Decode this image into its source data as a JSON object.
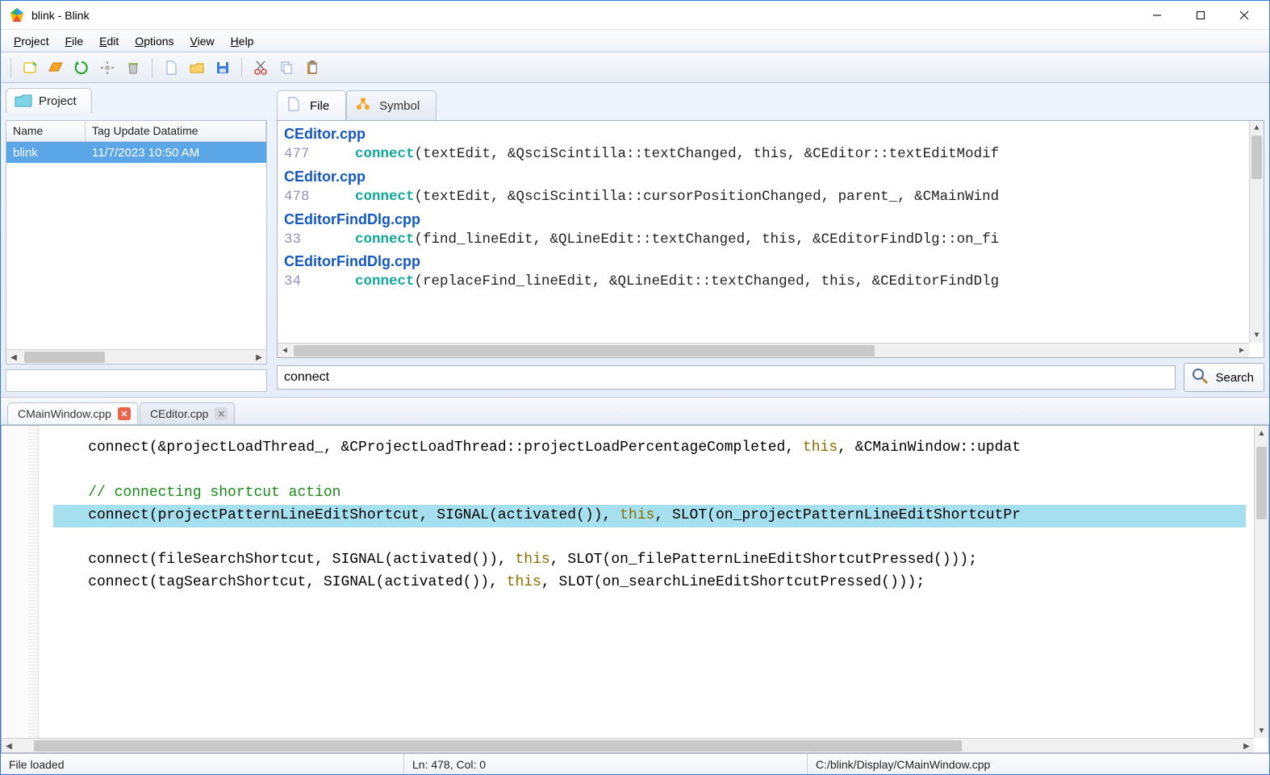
{
  "window": {
    "title": "blink - Blink"
  },
  "menu": {
    "items": [
      "Project",
      "File",
      "Edit",
      "Options",
      "View",
      "Help"
    ]
  },
  "left": {
    "tab_label": "Project",
    "columns": {
      "name": "Name",
      "dt": "Tag Update Datatime"
    },
    "rows": [
      {
        "name": "blink",
        "dt": "11/7/2023 10:50 AM"
      }
    ]
  },
  "right": {
    "tabs": {
      "file": "File",
      "symbol": "Symbol"
    },
    "results": [
      {
        "file": "CEditor.cpp",
        "line": "477",
        "keyword": "connect",
        "rest": "(textEdit, &QsciScintilla::textChanged, this, &CEditor::textEditModif"
      },
      {
        "file": "CEditor.cpp",
        "line": "478",
        "keyword": "connect",
        "rest": "(textEdit, &QsciScintilla::cursorPositionChanged, parent_, &CMainWind"
      },
      {
        "file": "CEditorFindDlg.cpp",
        "line": "33",
        "keyword": "connect",
        "rest": "(find_lineEdit, &QLineEdit::textChanged, this, &CEditorFindDlg::on_fi"
      },
      {
        "file": "CEditorFindDlg.cpp",
        "line": "34",
        "keyword": "connect",
        "rest": "(replaceFind_lineEdit, &QLineEdit::textChanged, this, &CEditorFindDlg"
      }
    ],
    "search_value": "connect",
    "search_button": "Search"
  },
  "editor": {
    "tabs": [
      {
        "label": "CMainWindow.cpp",
        "active": true,
        "dirty": true
      },
      {
        "label": "CEditor.cpp",
        "active": false,
        "dirty": false
      }
    ],
    "lines": {
      "l0a": "    connect(&projectLoadThread_, &CProjectLoadThread::projectLoadPercentageCompleted, ",
      "l0b": "this",
      "l0c": ", &CMainWindow::updat",
      "blank": "",
      "comment": "    // connecting shortcut action",
      "hl_a": "    connect(projectPatternLineEditShortcut, SIGNAL(activated()), ",
      "hl_b": "this",
      "hl_c": ", SLOT(on_projectPatternLineEditShortcutPr",
      "l3a": "    connect(fileSearchShortcut, SIGNAL(activated()), ",
      "l3b": "this",
      "l3c": ", SLOT(on_filePatternLineEditShortcutPressed()));",
      "l4a": "    connect(tagSearchShortcut, SIGNAL(activated()), ",
      "l4b": "this",
      "l4c": ", SLOT(on_searchLineEditShortcutPressed()));"
    }
  },
  "status": {
    "left": "File loaded",
    "mid": "Ln: 478, Col: 0",
    "right": "C:/blink/Display/CMainWindow.cpp"
  }
}
